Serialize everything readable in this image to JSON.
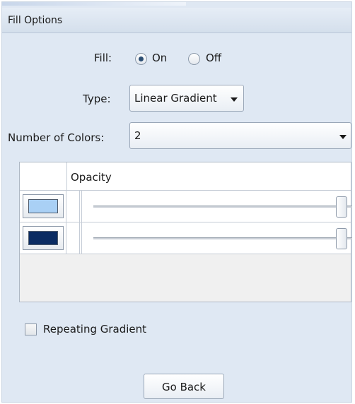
{
  "panel": {
    "title": "Fill Options"
  },
  "fill": {
    "label": "Fill:",
    "on_label": "On",
    "off_label": "Off",
    "selected": "On"
  },
  "type": {
    "label": "Type:",
    "value": "Linear Gradient"
  },
  "colors_count": {
    "label": "Number of Colors:",
    "value": "2"
  },
  "table": {
    "header": "Opacity",
    "rows": [
      {
        "color": "#a9d0f5",
        "opacity": 1.0
      },
      {
        "color": "#0b2c63",
        "opacity": 1.0
      }
    ]
  },
  "repeating": {
    "label": "Repeating Gradient",
    "checked": false
  },
  "go_back": {
    "label": "Go Back"
  }
}
